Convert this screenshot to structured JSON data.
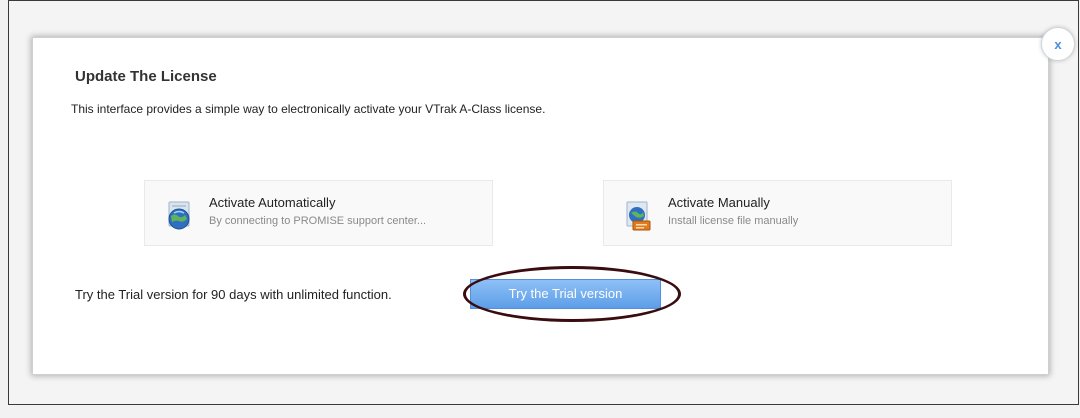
{
  "dialog": {
    "title": "Update The License",
    "description": "This interface provides a simple way to electronically activate your VTrak A-Class license.",
    "close_label": "x"
  },
  "options": [
    {
      "title": "Activate Automatically",
      "subtitle": "By connecting to PROMISE support center...",
      "icon": "globe-icon"
    },
    {
      "title": "Activate Manually",
      "subtitle": "Install license file manually",
      "icon": "license-file-icon"
    }
  ],
  "trial": {
    "text": "Try the Trial version for 90 days with unlimited function.",
    "button_label": "Try the Trial version"
  },
  "colors": {
    "accent": "#5d9ee8",
    "highlight_ring": "#3a0c10",
    "close": "#4d8fd8"
  }
}
